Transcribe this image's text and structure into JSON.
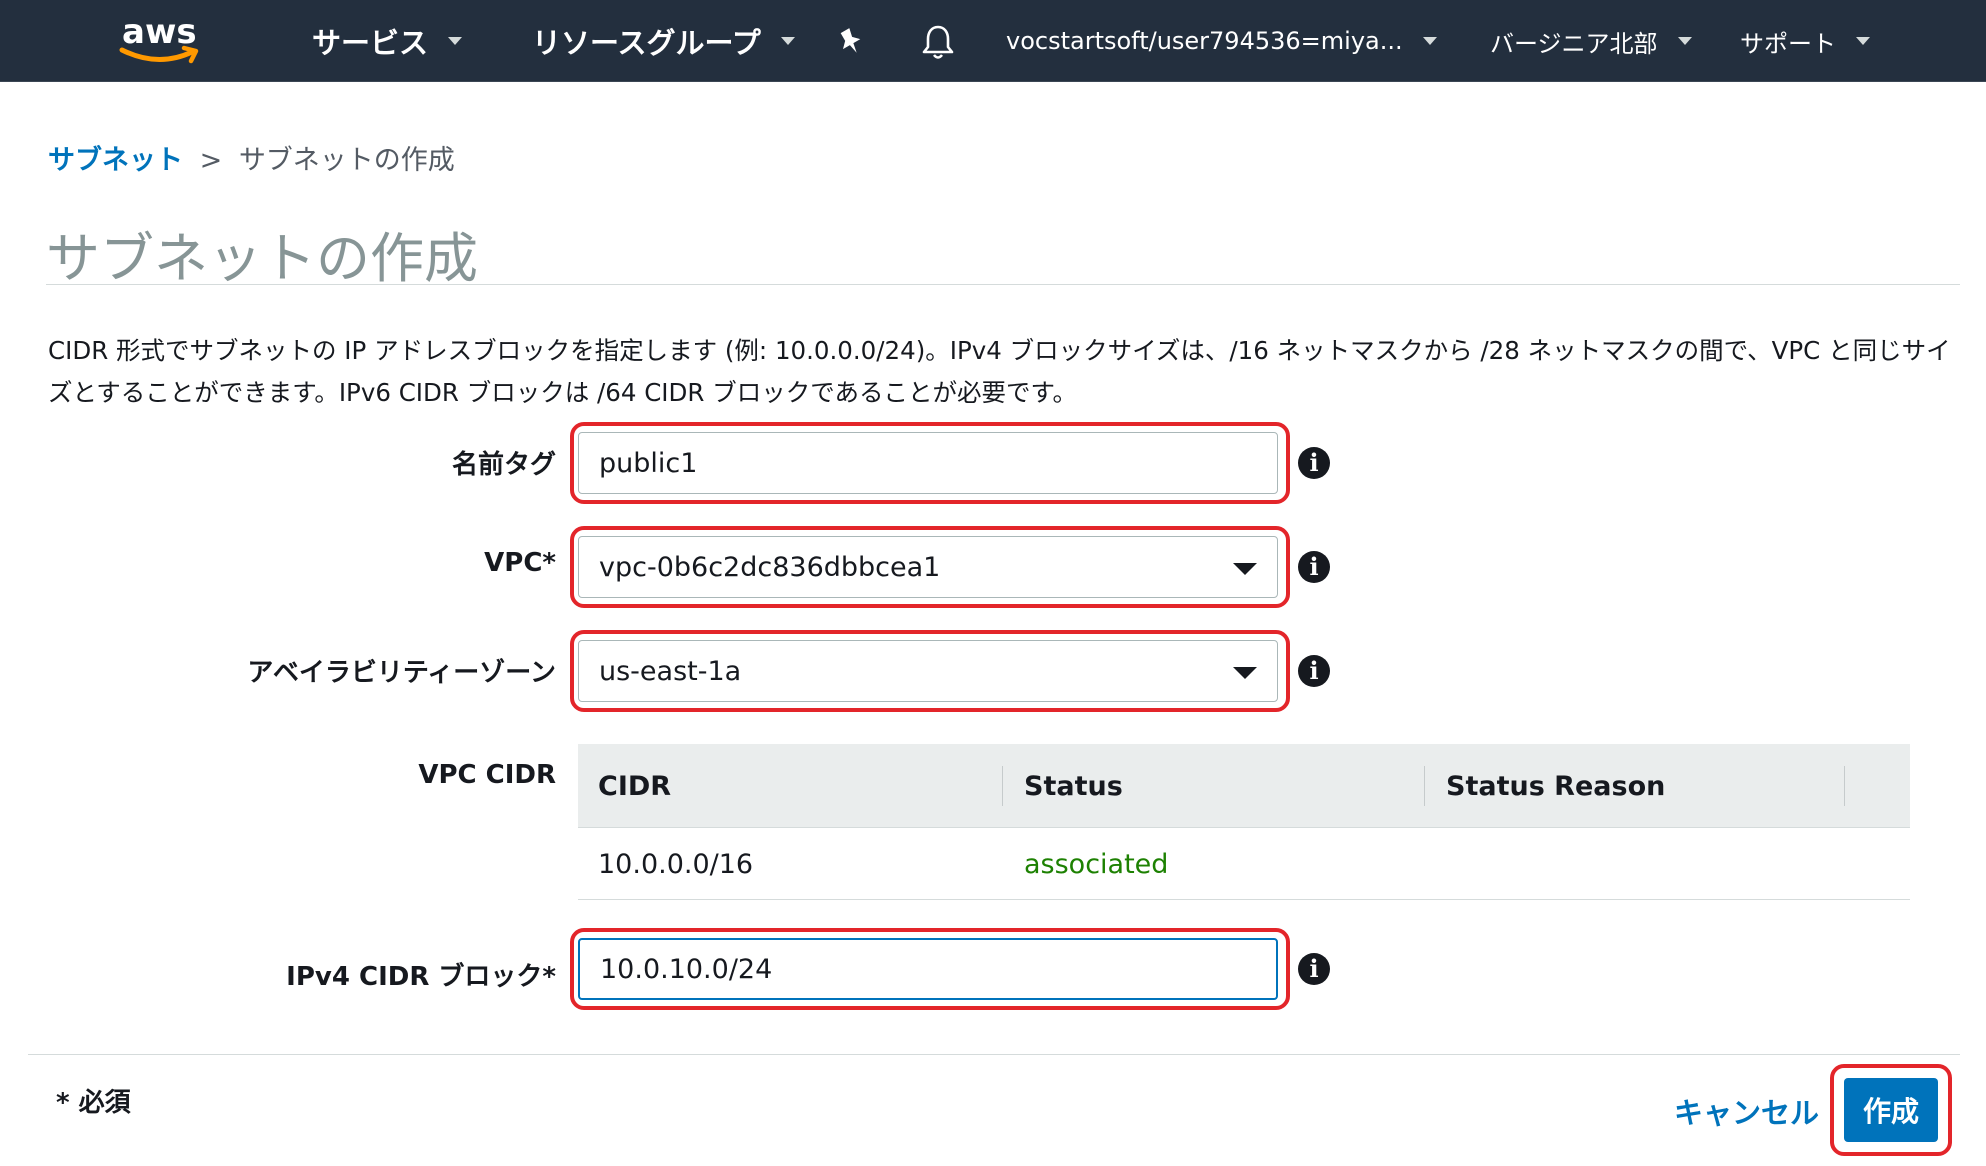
{
  "nav": {
    "logo_text": "aws",
    "services": "サービス",
    "resource_groups": "リソースグループ",
    "pin_icon": "pin-icon",
    "bell_icon": "bell-icon",
    "account": "vocstartsoft/user794536=miya...",
    "region": "バージニア北部",
    "support": "サポート",
    "colors": {
      "background": "#232f3e",
      "logo_smile": "#ff9900"
    }
  },
  "breadcrumb": {
    "parent": "サブネット",
    "separator": ">",
    "current": "サブネットの作成"
  },
  "page_title": "サブネットの作成",
  "description": "CIDR 形式でサブネットの IP アドレスブロックを指定します (例: 10.0.0.0/24)。IPv4 ブロックサイズは、/16 ネットマスクから /28 ネットマスクの間で、VPC と同じサイズとすることができます。IPv6 CIDR ブロックは /64 CIDR ブロックであることが必要です。",
  "form": {
    "name_tag": {
      "label": "名前タグ",
      "value": "public1"
    },
    "vpc": {
      "label": "VPC*",
      "value": "vpc-0b6c2dc836dbbcea1"
    },
    "az": {
      "label": "アベイラビリティーゾーン",
      "value": "us-east-1a"
    },
    "vpc_cidr": {
      "label": "VPC CIDR",
      "columns": [
        "CIDR",
        "Status",
        "Status Reason"
      ],
      "rows": [
        {
          "cidr": "10.0.0.0/16",
          "status": "associated",
          "reason": ""
        }
      ]
    },
    "ipv4_cidr": {
      "label": "IPv4 CIDR ブロック*",
      "value": "10.0.10.0/24"
    },
    "info_icon": "info-icon"
  },
  "footer": {
    "required_note": "* 必須",
    "cancel": "キャンセル",
    "create": "作成"
  },
  "colors": {
    "link": "#0073bb",
    "primary_button": "#0073bb",
    "status_ok": "#1d8102",
    "highlight": "#e3252a"
  }
}
